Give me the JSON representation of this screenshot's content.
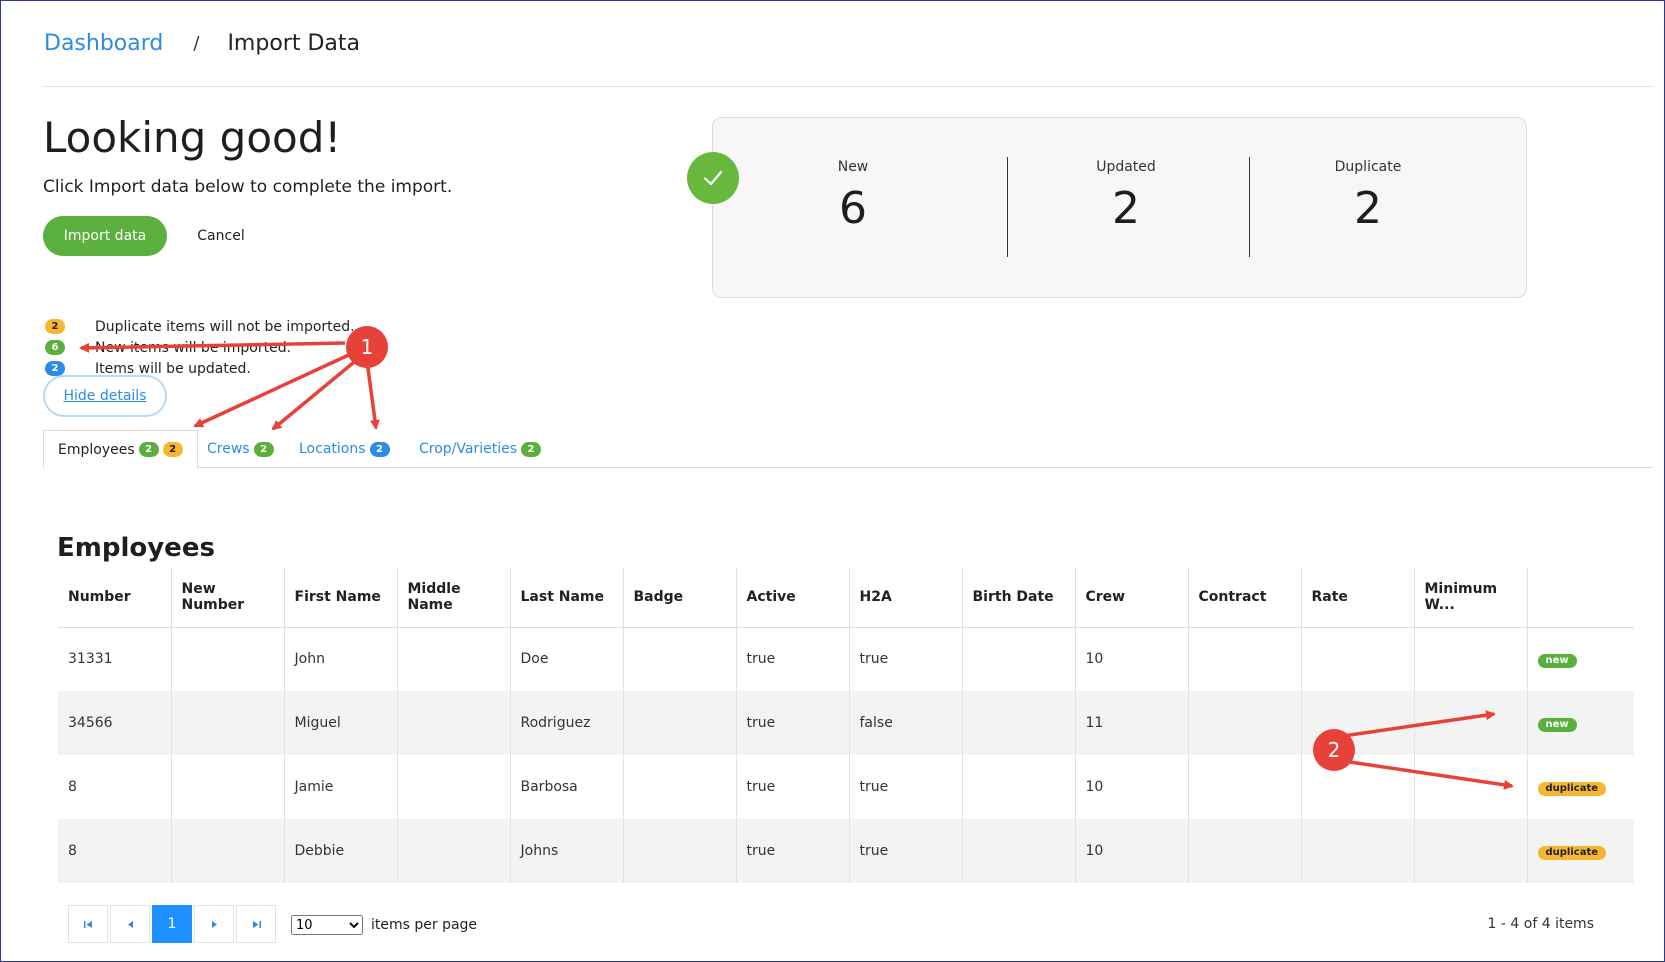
{
  "breadcrumb": {
    "root": "Dashboard",
    "separator": "/",
    "current": "Import Data"
  },
  "header": {
    "title": "Looking good!",
    "subtitle": "Click Import data below to complete the import.",
    "import_button": "Import data",
    "cancel_button": "Cancel"
  },
  "summary": {
    "new_label": "New",
    "new_value": "6",
    "updated_label": "Updated",
    "updated_value": "2",
    "duplicate_label": "Duplicate",
    "duplicate_value": "2"
  },
  "legend": [
    {
      "count": "2",
      "color": "orange",
      "text": "Duplicate items will not be imported."
    },
    {
      "count": "6",
      "color": "green",
      "text": "New items will be imported."
    },
    {
      "count": "2",
      "color": "blue",
      "text": "Items will be updated."
    }
  ],
  "hide_details": "Hide details",
  "tabs": [
    {
      "label": "Employees",
      "badges": [
        {
          "value": "2",
          "color": "green"
        },
        {
          "value": "2",
          "color": "orange"
        }
      ]
    },
    {
      "label": "Crews",
      "badges": [
        {
          "value": "2",
          "color": "green"
        }
      ]
    },
    {
      "label": "Locations",
      "badges": [
        {
          "value": "2",
          "color": "blue"
        }
      ]
    },
    {
      "label": "Crop/Varieties",
      "badges": [
        {
          "value": "2",
          "color": "green"
        }
      ]
    }
  ],
  "table": {
    "title": "Employees",
    "columns": [
      "Number",
      "New Number",
      "First Name",
      "Middle Name",
      "Last Name",
      "Badge",
      "Active",
      "H2A",
      "Birth Date",
      "Crew",
      "Contract",
      "Rate",
      "Minimum W...",
      ""
    ],
    "rows": [
      [
        "31331",
        "",
        "John",
        "",
        "Doe",
        "",
        "true",
        "true",
        "",
        "10",
        "",
        "",
        "",
        "new"
      ],
      [
        "34566",
        "",
        "Miguel",
        "",
        "Rodriguez",
        "",
        "true",
        "false",
        "",
        "11",
        "",
        "",
        "",
        "new"
      ],
      [
        "8",
        "",
        "Jamie",
        "",
        "Barbosa",
        "",
        "true",
        "true",
        "",
        "10",
        "",
        "",
        "",
        "duplicate"
      ],
      [
        "8",
        "",
        "Debbie",
        "",
        "Johns",
        "",
        "true",
        "true",
        "",
        "10",
        "",
        "",
        "",
        "duplicate"
      ]
    ]
  },
  "pager": {
    "current_page": "1",
    "page_size": "10",
    "page_size_options": [
      "10"
    ],
    "items_per_page_label": "items per page",
    "range_text": "1 - 4 of 4 items"
  },
  "annotations": {
    "callout_1": "1",
    "callout_2": "2",
    "color": "#e8413a"
  },
  "colors": {
    "accent": "#2b8be6",
    "success": "#5aaf3f",
    "warning": "#f5b731"
  }
}
